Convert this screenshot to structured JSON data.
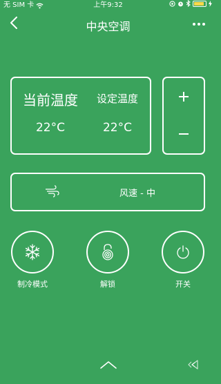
{
  "status_bar": {
    "carrier": "无 SIM 卡",
    "time": "上午9:32",
    "battery_level": 0.9
  },
  "nav": {
    "title": "中央空调"
  },
  "temperature": {
    "current_label": "当前温度",
    "current_value": "22°C",
    "set_label": "设定温度",
    "set_value": "22°C"
  },
  "adjust": {
    "increase_label": "+",
    "decrease_label": "—"
  },
  "fan": {
    "label": "风速 - 中",
    "icon": "wind-icon"
  },
  "modes": [
    {
      "label": "制冷模式",
      "icon": "snowflake-icon"
    },
    {
      "label": "解锁",
      "icon": "unlock-icon"
    },
    {
      "label": "开关",
      "icon": "power-icon"
    }
  ],
  "bottom": {
    "expand_icon": "chevron-up-icon",
    "sound_icon": "audio-icon"
  }
}
